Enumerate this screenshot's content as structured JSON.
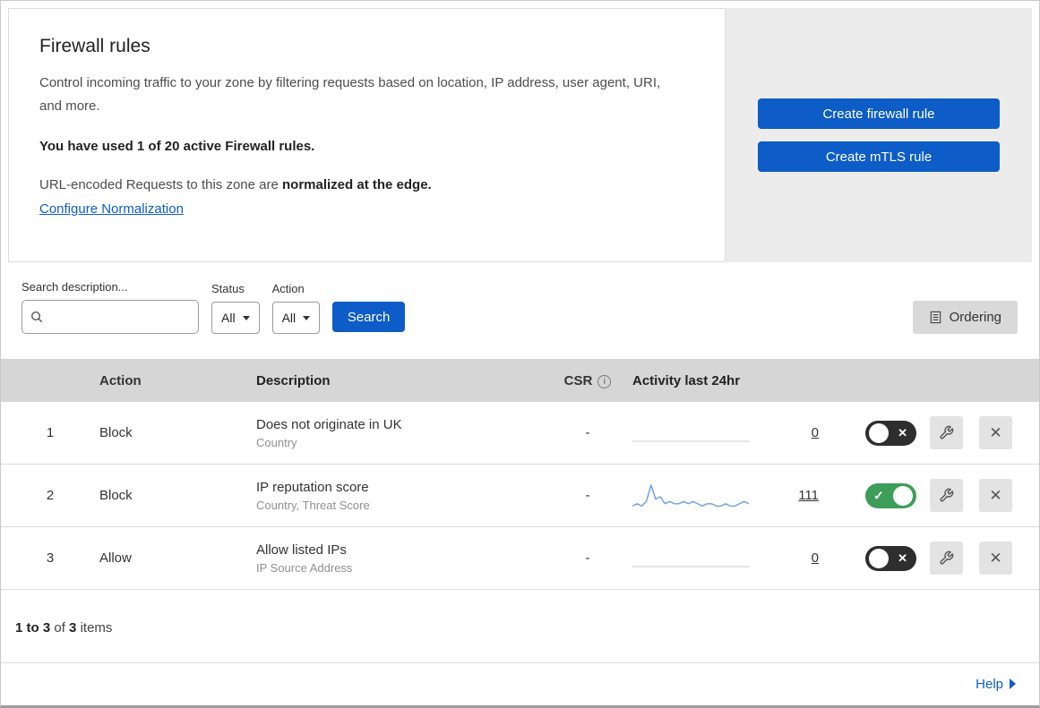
{
  "intro": {
    "title": "Firewall rules",
    "description": "Control incoming traffic to your zone by filtering requests based on location, IP address, user agent, URI, and more.",
    "usage_note": "You have used 1 of 20 active Firewall rules.",
    "normalization_text": "URL-encoded Requests to this zone are",
    "normalization_bold": "normalized at the edge.",
    "normalization_link": "Configure Normalization",
    "create_firewall_button": "Create firewall rule",
    "create_mtls_button": "Create mTLS rule"
  },
  "filters": {
    "search_label": "Search description...",
    "status_label": "Status",
    "status_value": "All",
    "action_label": "Action",
    "action_value": "All",
    "search_button": "Search",
    "ordering_button": "Ordering"
  },
  "table": {
    "headers": {
      "action": "Action",
      "description": "Description",
      "csr": "CSR",
      "activity": "Activity last 24hr"
    },
    "rows": [
      {
        "priority": "1",
        "action": "Block",
        "description": "Does not originate in UK",
        "fields": "Country",
        "csr": "-",
        "activity_count": "0",
        "enabled": false,
        "sparkline": []
      },
      {
        "priority": "2",
        "action": "Block",
        "description": "IP reputation score",
        "fields": "Country, Threat Score",
        "csr": "-",
        "activity_count": "111",
        "enabled": true,
        "sparkline": [
          1,
          2,
          1,
          3,
          10,
          4,
          5,
          2,
          3,
          2,
          2,
          3,
          2,
          3,
          2,
          1,
          2,
          2,
          1,
          1,
          2,
          1,
          1,
          2,
          3,
          2
        ]
      },
      {
        "priority": "3",
        "action": "Allow",
        "description": "Allow listed IPs",
        "fields": "IP Source Address",
        "csr": "-",
        "activity_count": "0",
        "enabled": false,
        "sparkline": []
      }
    ]
  },
  "pagination": {
    "range": "1 to 3",
    "of": "of",
    "total": "3",
    "items": "items"
  },
  "help_link": "Help",
  "colors": {
    "accent_blue": "#0d5cc7",
    "toggle_green": "#3c9e58",
    "toggle_off": "#2e2e2e",
    "sparkline_blue": "#6f9fe6",
    "table_header_bg": "#d6d6d6",
    "panel_bg": "#ececec"
  }
}
